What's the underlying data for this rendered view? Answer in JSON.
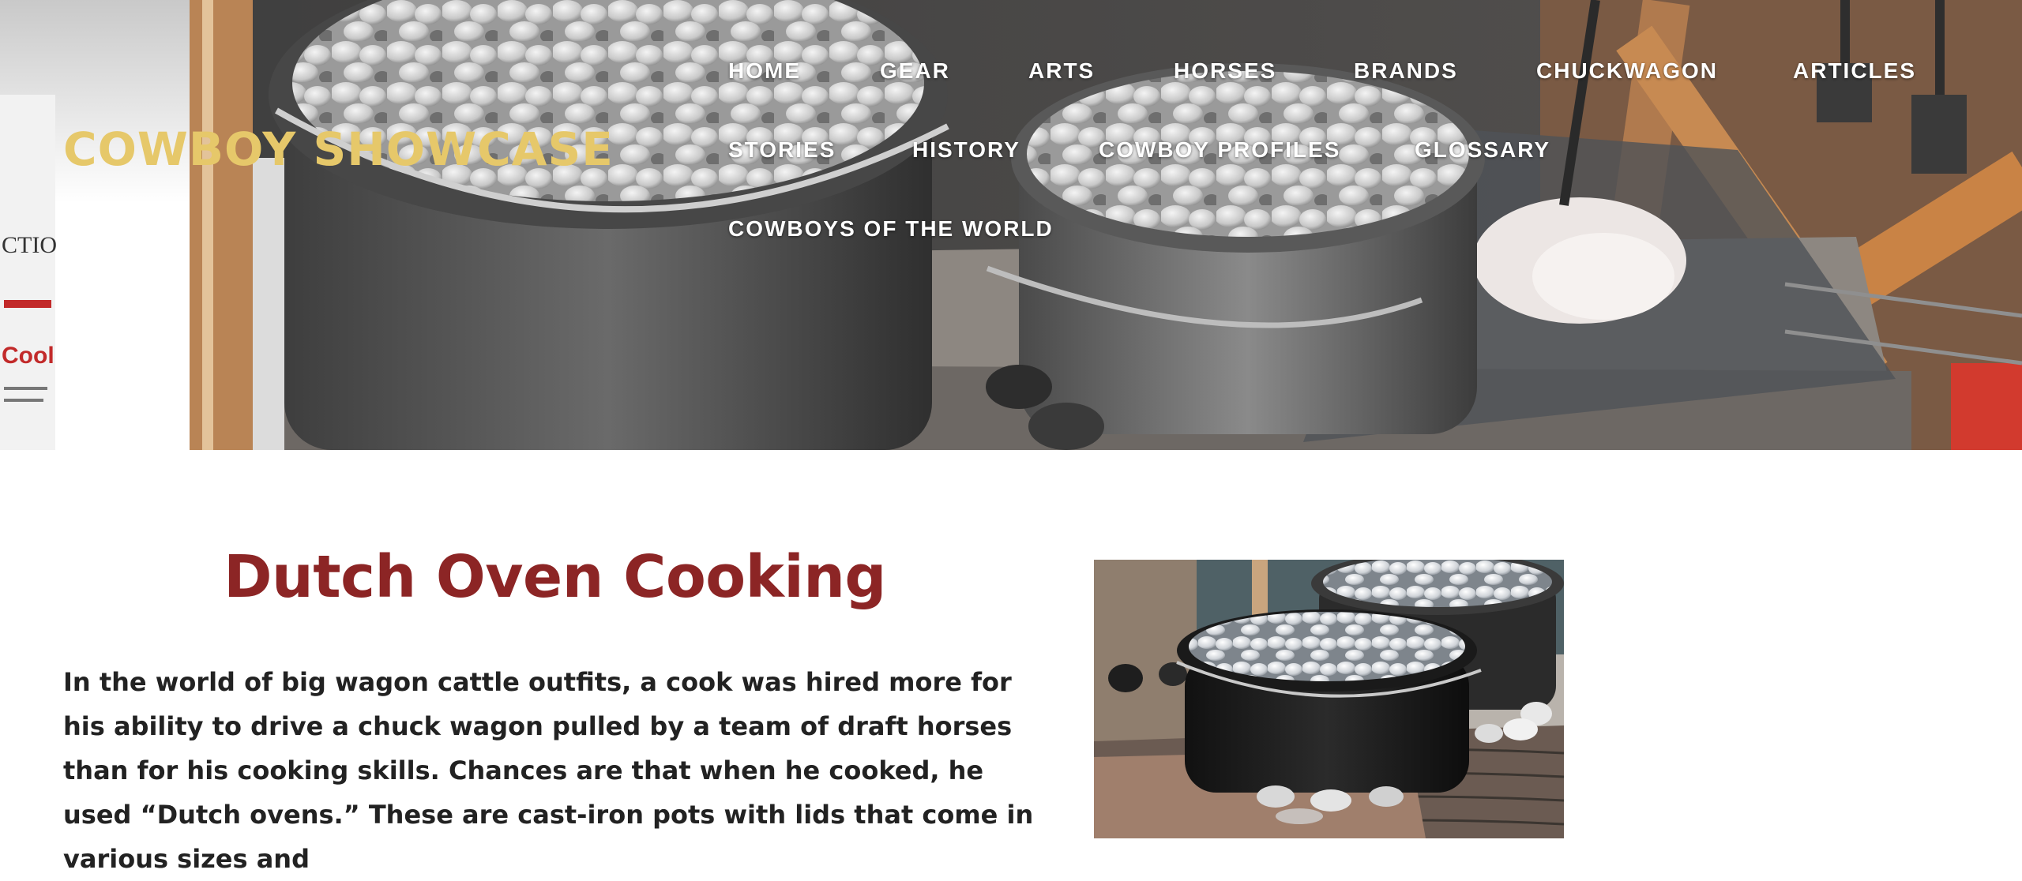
{
  "header": {
    "site_title": "COWBOY SHOWCASE",
    "nav": [
      {
        "label": "HOME"
      },
      {
        "label": "GEAR"
      },
      {
        "label": "ARTS"
      },
      {
        "label": "HORSES"
      },
      {
        "label": "BRANDS"
      },
      {
        "label": "CHUCKWAGON"
      },
      {
        "label": "ARTICLES"
      },
      {
        "label": "STORIES"
      },
      {
        "label": "HISTORY"
      },
      {
        "label": "COWBOY PROFILES"
      },
      {
        "label": "GLOSSARY"
      },
      {
        "label": "COWBOYS OF THE WORLD"
      }
    ]
  },
  "main": {
    "heading": "Dutch Oven Cooking",
    "paragraph": "In the world of big wagon cattle outfits, a cook was hired more for his ability to drive a chuck wagon pulled by a team of draft horses than for his cooking skills.  Chances are that when he cooked, he used “Dutch ovens.”  These are cast-iron pots with lids that come in various sizes and"
  },
  "colors": {
    "site_title": "#e6c86a",
    "heading": "#8c2525",
    "body_text": "#222222",
    "nav_text": "#ffffff"
  }
}
